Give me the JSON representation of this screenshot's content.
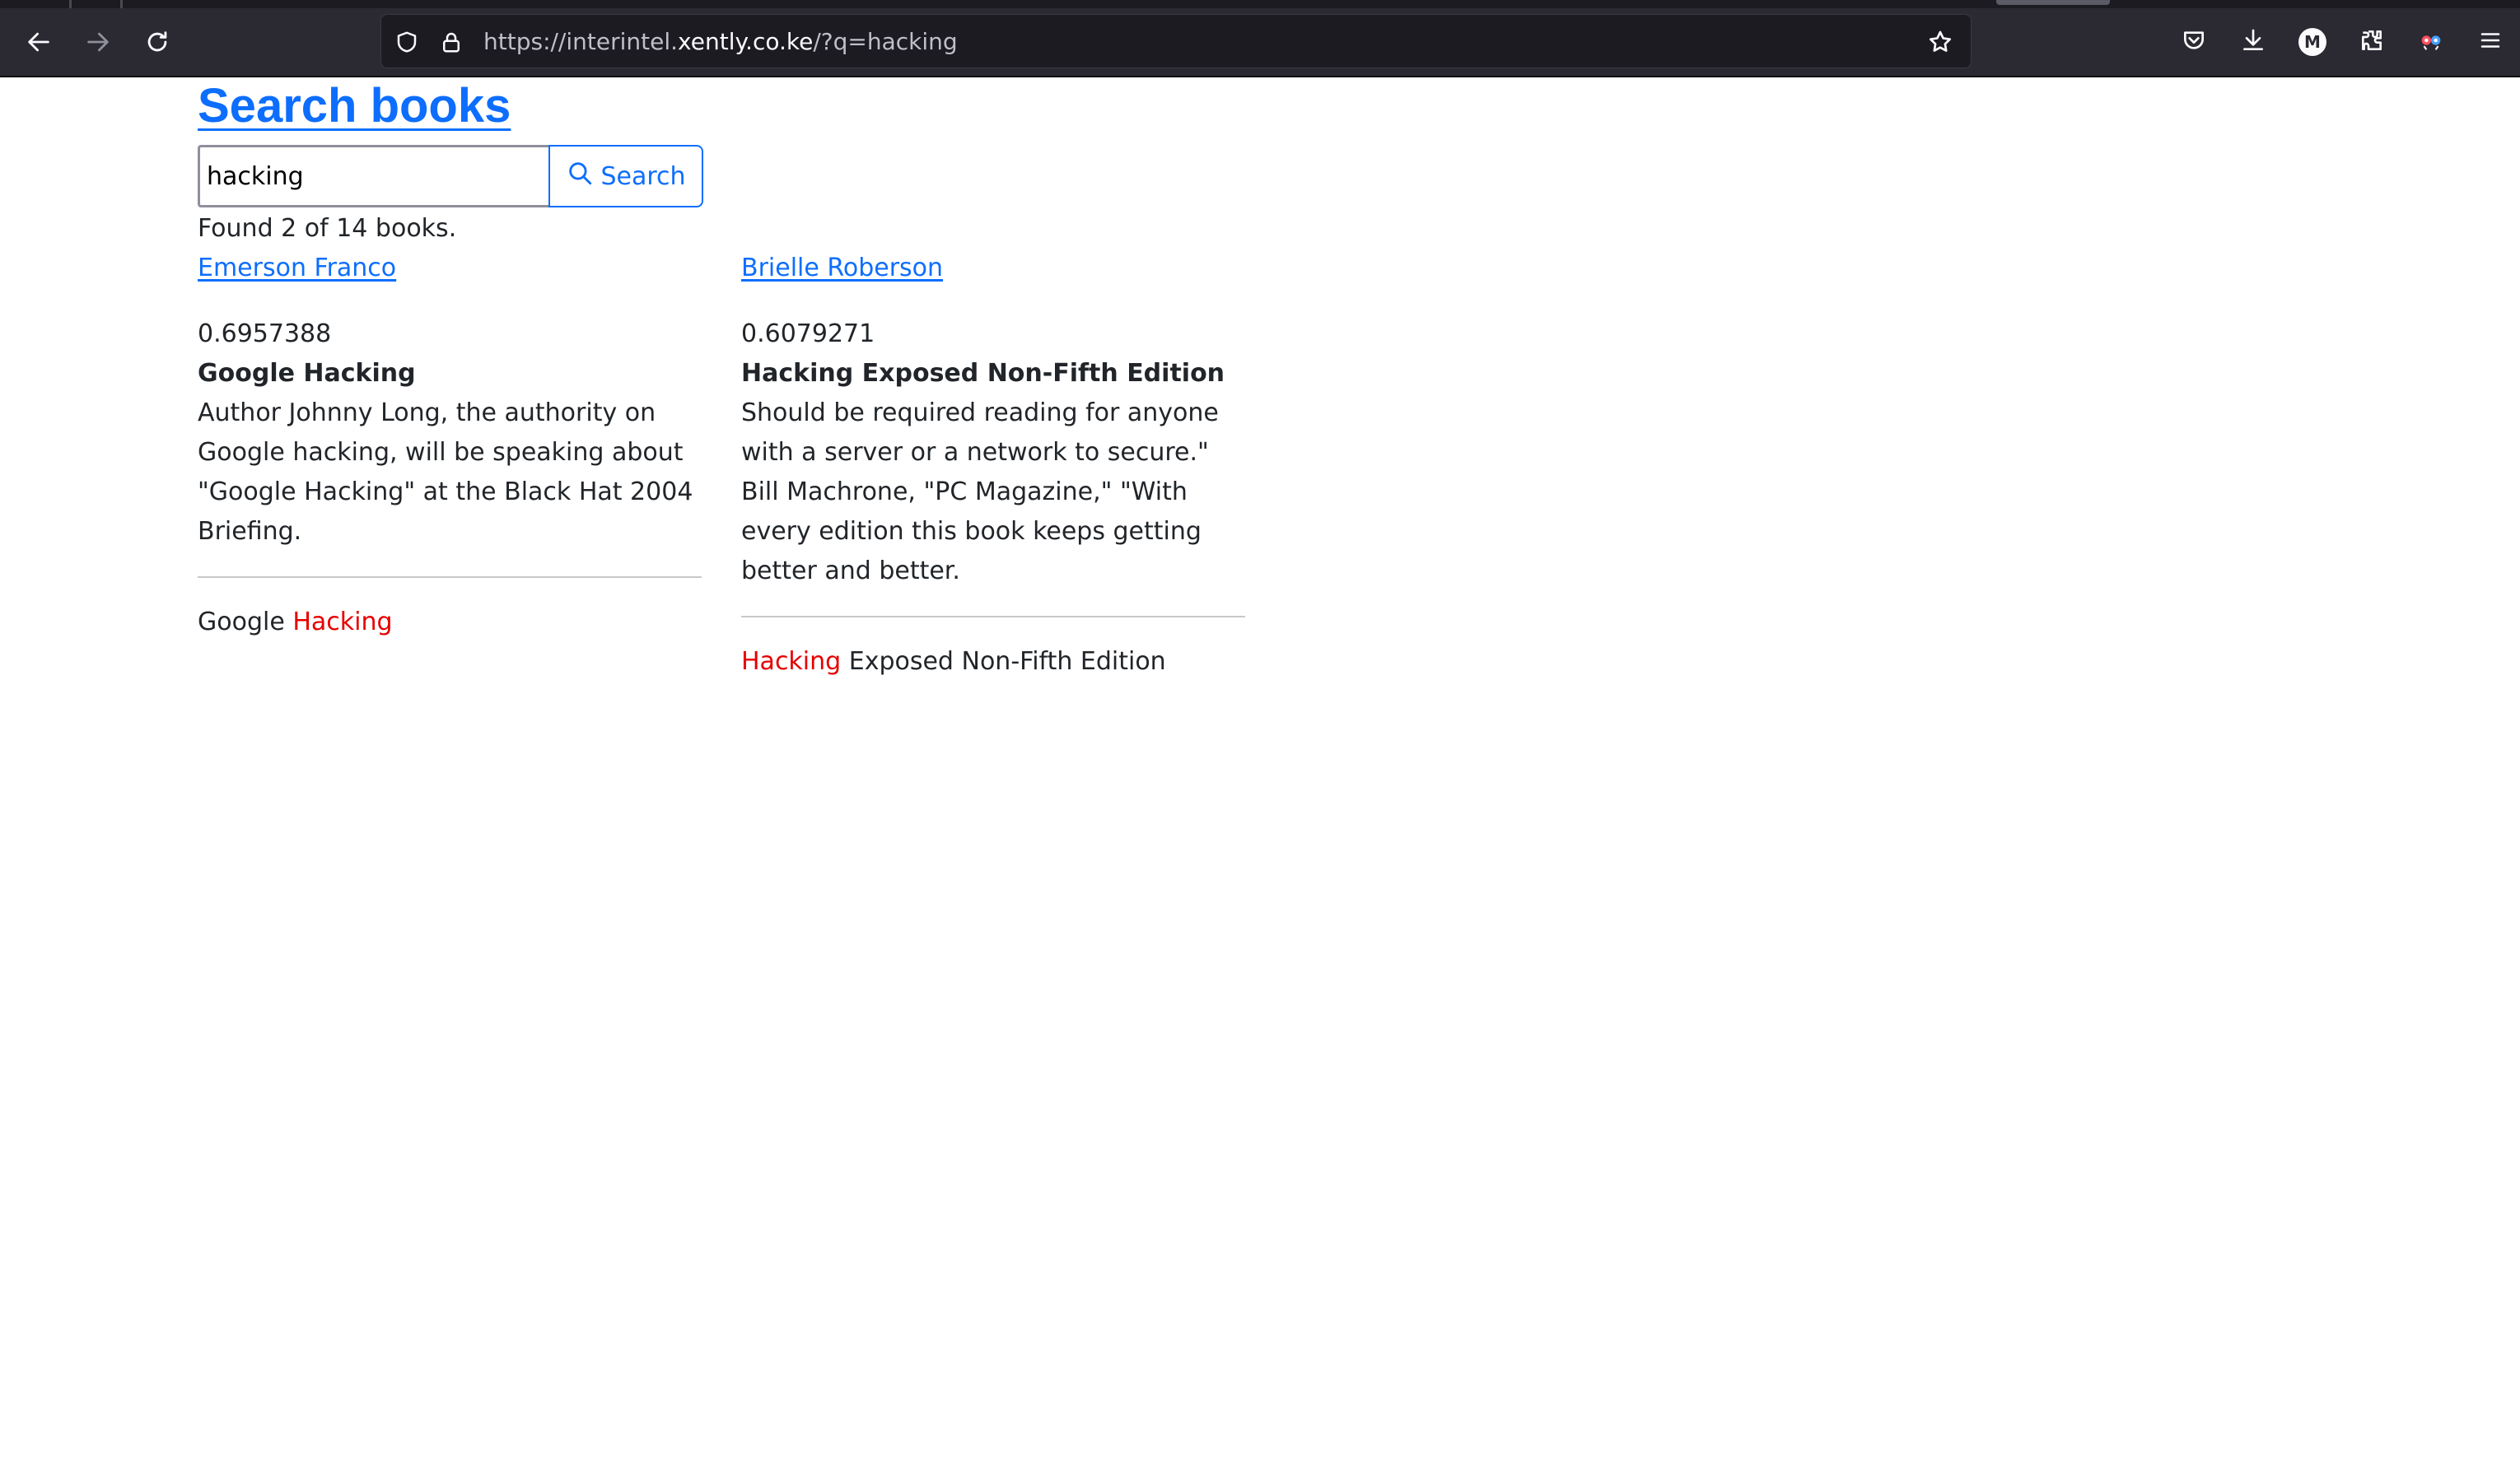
{
  "browser": {
    "url_prefix": "https://interintel.",
    "url_host": "xently.co.ke",
    "url_suffix": "/?q=hacking",
    "profile_initial": "M",
    "icons": [
      "back-icon",
      "forward-icon",
      "reload-icon",
      "shield-icon",
      "lock-icon",
      "star-icon",
      "pocket-icon",
      "download-icon",
      "profile-icon",
      "extensions-icon",
      "container-icon",
      "menu-icon"
    ]
  },
  "page": {
    "title": "Search books",
    "search": {
      "value": "hacking",
      "button_label": "Search"
    },
    "found_text": "Found 2 of 14 books.",
    "results": [
      {
        "author": "Emerson Franco",
        "score": "0.6957388",
        "title": "Google Hacking",
        "description": "Author Johnny Long, the authority on Google hacking, will be speaking about \"Google Hacking\" at the Black Hat 2004 Briefing.",
        "highlight_before": "Google ",
        "highlight_term": "Hacking",
        "highlight_after": ""
      },
      {
        "author": "Brielle Roberson",
        "score": "0.6079271",
        "title": "Hacking Exposed Non-Fifth Edition",
        "description": "Should be required reading for anyone with a server or a network to secure.\" Bill Machrone, \"PC Magazine,\" \"With every edition this book keeps getting better and better.",
        "highlight_before": "",
        "highlight_term": "Hacking",
        "highlight_after": " Exposed Non-Fifth Edition"
      }
    ]
  },
  "colors": {
    "link": "#0d6efd",
    "highlight": "#e60000",
    "chrome_bg": "#2b2a33"
  }
}
